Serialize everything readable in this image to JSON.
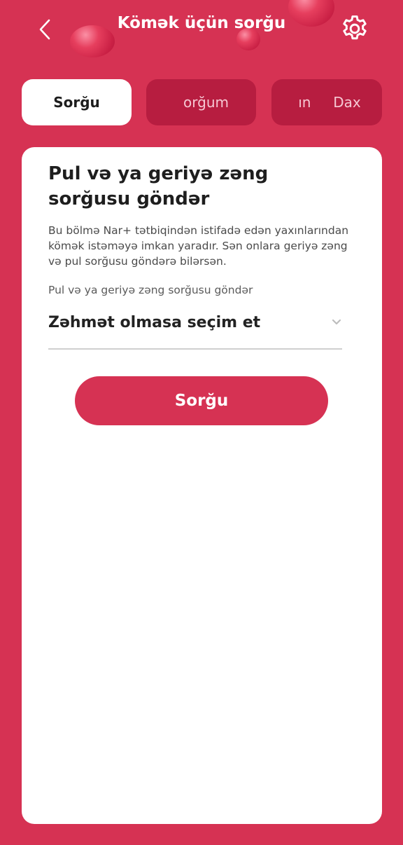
{
  "colors": {
    "brand": "#d63253",
    "tab_inactive": "#b71d40",
    "card": "#ffffff"
  },
  "header": {
    "title": "Kömək üçün sorğu",
    "back_icon": "chevron-left-icon",
    "settings_icon": "gear-icon"
  },
  "tabs": [
    {
      "label": "Sorğu",
      "active": true
    },
    {
      "label": "orğum",
      "active": false
    },
    {
      "label": "ın     Dax",
      "active": false
    }
  ],
  "card": {
    "title": "Pul və ya geriyə zəng sorğusu göndər",
    "description": "Bu bölmə Nar+ tətbiqindən istifadə edən yaxınlarından kömək istəməyə imkan yaradır. Sən onlara geriyə zəng və pul sorğusu göndərə bilərsən.",
    "field_label": "Pul və ya geriyə zəng sorğusu göndər",
    "select_value": "Zəhmət olmasa seçim et",
    "select_icon": "chevron-down-icon",
    "submit_label": "Sorğu"
  }
}
